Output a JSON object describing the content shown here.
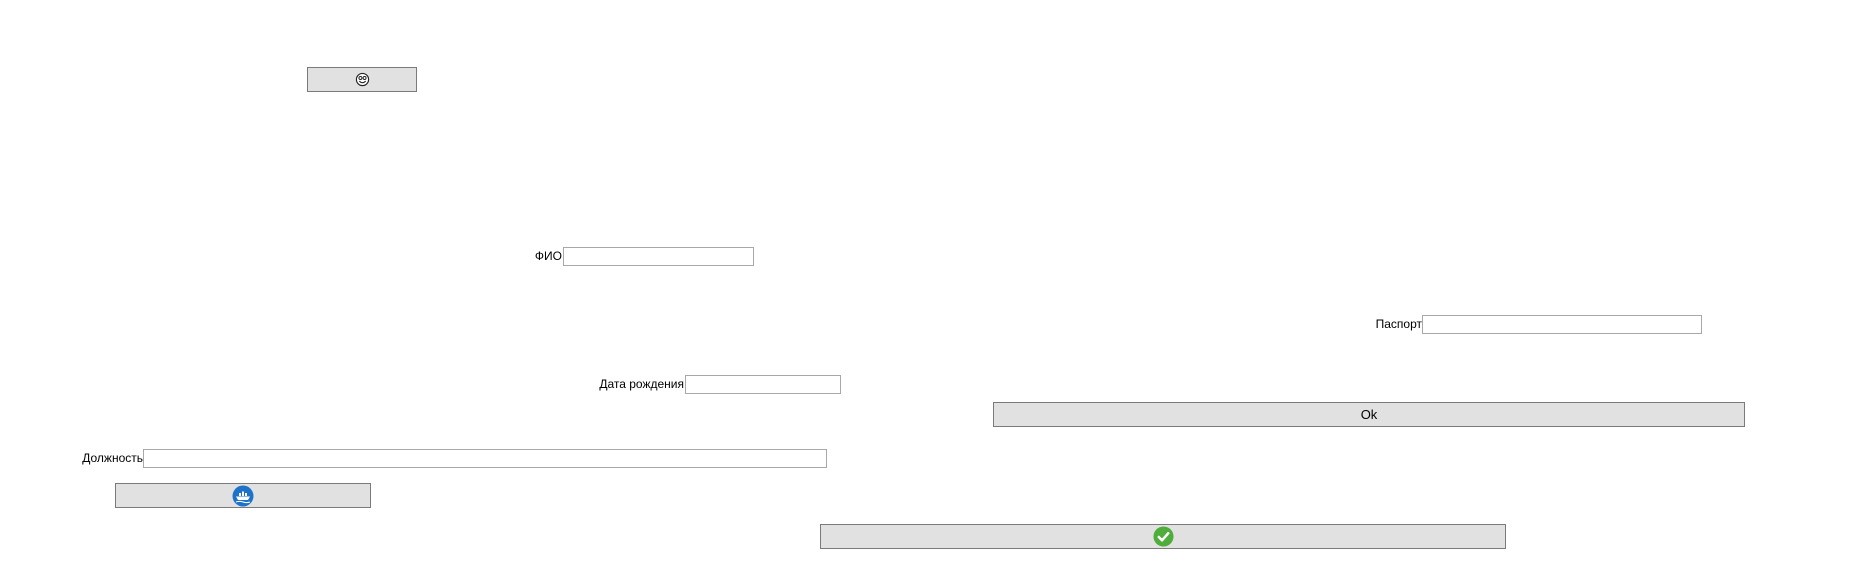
{
  "top_button": {
    "icon": "smiley-face-icon"
  },
  "fields": {
    "fio": {
      "label": "ФИО",
      "value": "",
      "placeholder": ""
    },
    "passport": {
      "label": "Паспорт",
      "value": "",
      "placeholder": ""
    },
    "birth_date": {
      "label": "Дата рождения",
      "value": "",
      "placeholder": ""
    },
    "position": {
      "label": "Должность",
      "value": "",
      "placeholder": ""
    }
  },
  "ok_button": {
    "label": "Ok"
  },
  "image_button": {
    "icon": "boat-icon",
    "icon_color": "#1e73c8"
  },
  "confirm_button": {
    "icon": "checkmark-icon",
    "icon_color": "#4fae3b"
  }
}
